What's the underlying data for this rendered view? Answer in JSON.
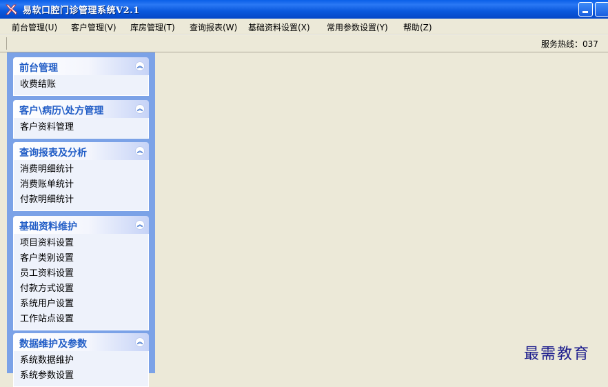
{
  "window": {
    "title": "易软口腔门诊管理系统V2.1"
  },
  "menu": [
    {
      "label": "前台管理(U)"
    },
    {
      "label": "客户管理(V)"
    },
    {
      "label": "库房管理(T)"
    },
    {
      "label": "查询报表(W)"
    },
    {
      "label": "基础资料设置(X)"
    },
    {
      "label": "常用参数设置(Y)"
    },
    {
      "label": "帮助(Z)"
    }
  ],
  "toolbar": {
    "hotline": "服务热线：037"
  },
  "sidebar": {
    "panels": [
      {
        "title": "前台管理",
        "collapse_icon": "double-chevron-up-icon",
        "items": [
          "收费结账"
        ]
      },
      {
        "title": "客户\\病历\\处方管理",
        "collapse_icon": "double-chevron-up-icon",
        "items": [
          "客户资料管理"
        ]
      },
      {
        "title": "查询报表及分析",
        "collapse_icon": "double-chevron-up-icon",
        "items": [
          "消费明细统计",
          "消费账单统计",
          "付款明细统计"
        ]
      },
      {
        "title": "基础资料维护",
        "collapse_icon": "double-chevron-up-icon",
        "items": [
          "项目资料设置",
          "客户类别设置",
          "员工资料设置",
          "付款方式设置",
          "系统用户设置",
          "工作站点设置"
        ]
      },
      {
        "title": "数据维护及参数",
        "collapse_icon": "double-chevron-up-icon",
        "items": [
          "系统数据维护",
          "系统参数设置"
        ]
      }
    ]
  },
  "watermark": "最需教育",
  "colors": {
    "titlebar": "#0a58dd",
    "sidebar_bg": "#7ba2e7",
    "panel_title": "#215dc6",
    "window_bg": "#ece9d8"
  }
}
